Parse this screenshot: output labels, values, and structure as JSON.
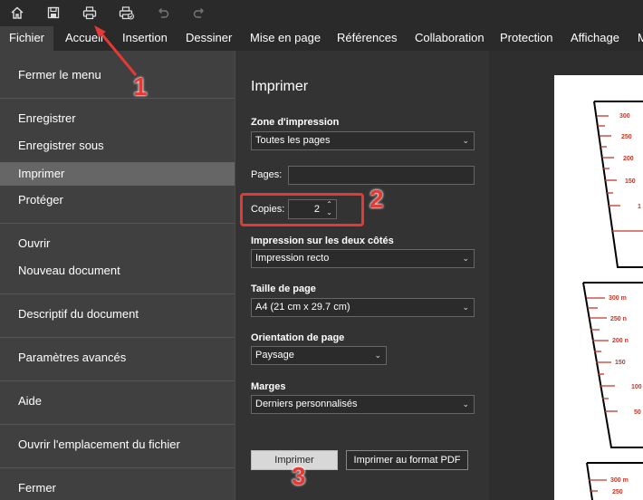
{
  "quick_access": {
    "icons": [
      "home-icon",
      "save-icon",
      "print-icon",
      "print-preview-icon",
      "undo-icon",
      "redo-icon"
    ]
  },
  "tabs": [
    {
      "label": "Fichier",
      "active": true
    },
    {
      "label": "Accueil"
    },
    {
      "label": "Insertion"
    },
    {
      "label": "Dessiner"
    },
    {
      "label": "Mise en page"
    },
    {
      "label": "Références"
    },
    {
      "label": "Collaboration"
    },
    {
      "label": "Protection"
    },
    {
      "label": "Affichage"
    },
    {
      "label": "M"
    }
  ],
  "file_menu": {
    "items": [
      {
        "label": "Fermer le menu"
      },
      {
        "label": "Enregistrer"
      },
      {
        "label": "Enregistrer sous"
      },
      {
        "label": "Imprimer",
        "selected": true
      },
      {
        "label": "Protéger"
      },
      {
        "label": "Ouvrir"
      },
      {
        "label": "Nouveau document"
      },
      {
        "label": "Descriptif du document"
      },
      {
        "label": "Paramètres avancés"
      },
      {
        "label": "Aide"
      },
      {
        "label": "Ouvrir l'emplacement du fichier"
      },
      {
        "label": "Fermer"
      }
    ]
  },
  "print": {
    "title": "Imprimer",
    "zone_label": "Zone d'impression",
    "zone_value": "Toutes les pages",
    "pages_label": "Pages:",
    "pages_value": "",
    "copies_label": "Copies:",
    "copies_value": "2",
    "duplex_label": "Impression sur les deux côtés",
    "duplex_value": "Impression recto",
    "size_label": "Taille de page",
    "size_value": "A4 (21 cm x 29.7 cm)",
    "orientation_label": "Orientation de page",
    "orientation_value": "Paysage",
    "margins_label": "Marges",
    "margins_value": "Derniers personnalisés",
    "print_button": "Imprimer",
    "pdf_button": "Imprimer au format PDF"
  },
  "preview": {
    "scale_groups": [
      {
        "labels": [
          "300",
          "250",
          "200",
          "150",
          "1"
        ]
      },
      {
        "labels": [
          "300 m",
          "250 n",
          "200 n",
          "150",
          "100",
          "50"
        ]
      },
      {
        "labels": [
          "300 m",
          "250"
        ]
      }
    ]
  },
  "annotations": {
    "step1": "1",
    "step2": "2",
    "step3": "3",
    "color": "#e53935"
  },
  "colors": {
    "accent_red": "#e53935",
    "scale_red": "#c0392b",
    "menu_bg": "#404040",
    "selected_bg": "#666666"
  }
}
